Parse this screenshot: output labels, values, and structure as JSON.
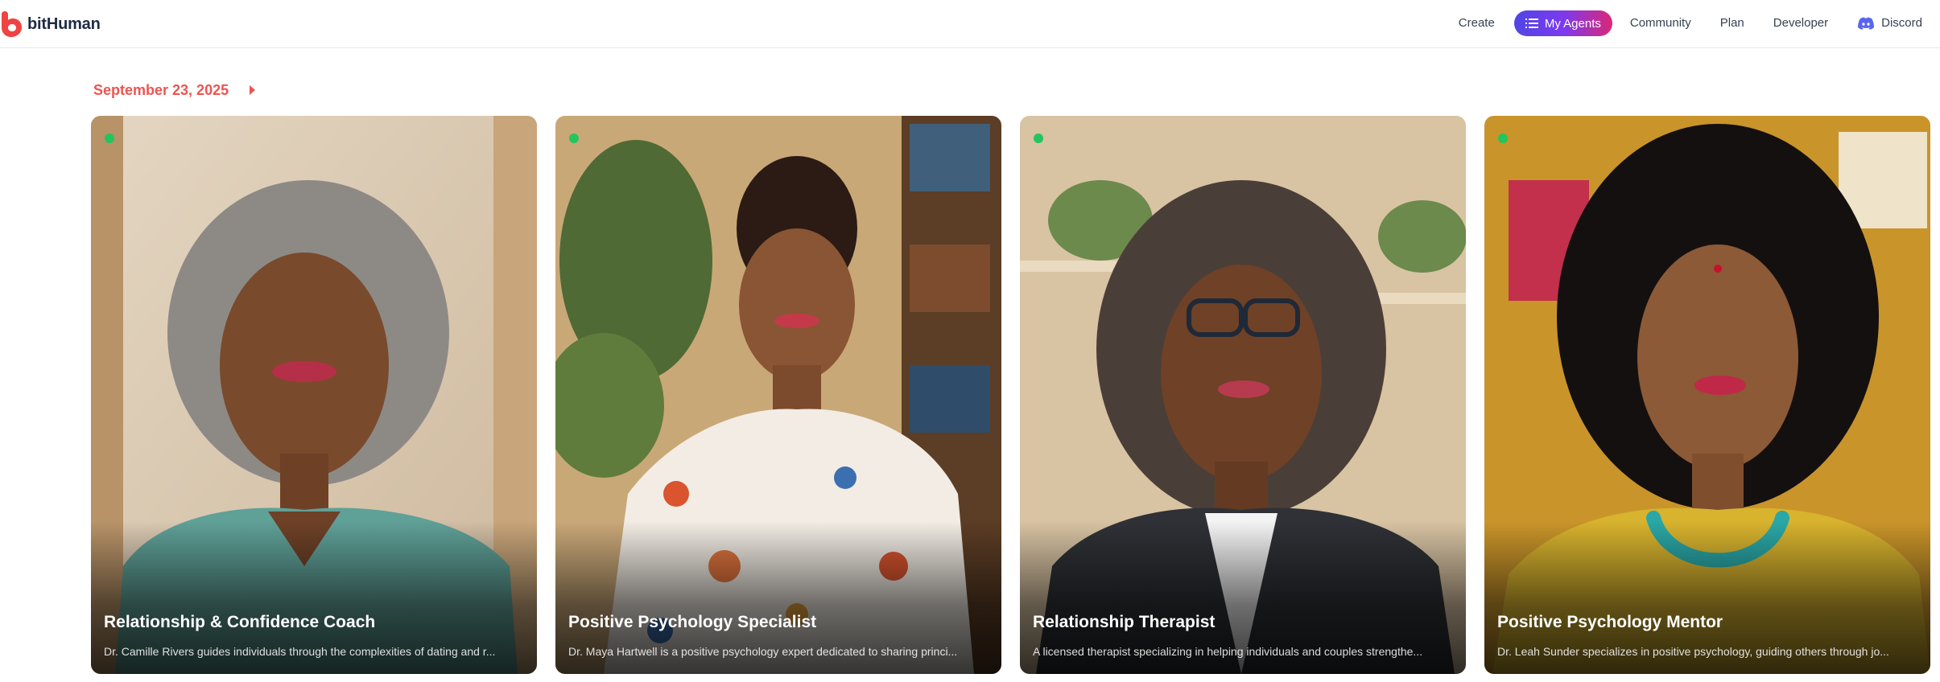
{
  "header": {
    "logo_text": "bitHuman",
    "nav": [
      {
        "label": "Create"
      },
      {
        "label": "My Agents",
        "active": true,
        "icon": "list-icon"
      },
      {
        "label": "Community"
      },
      {
        "label": "Plan"
      },
      {
        "label": "Developer"
      },
      {
        "label": "Discord",
        "icon": "discord-icon"
      }
    ]
  },
  "date_group": {
    "label": "September 23, 2025"
  },
  "agents": [
    {
      "title": "Relationship & Confidence Coach",
      "description": "Dr. Camille Rivers guides individuals through the complexities of dating and r...",
      "online": true
    },
    {
      "title": "Positive Psychology Specialist",
      "description": "Dr. Maya Hartwell is a positive psychology expert dedicated to sharing princi...",
      "online": true
    },
    {
      "title": "Relationship Therapist",
      "description": "A licensed therapist specializing in helping individuals and couples strengthe...",
      "online": true
    },
    {
      "title": "Positive Psychology Mentor",
      "description": "Dr. Leah Sunder specializes in positive psychology, guiding others through jo...",
      "online": true
    }
  ],
  "colors": {
    "accent_red": "#ef5350",
    "pill_gradient_start": "#4f46e5",
    "pill_gradient_end": "#db2777",
    "online_green": "#22c55e"
  }
}
